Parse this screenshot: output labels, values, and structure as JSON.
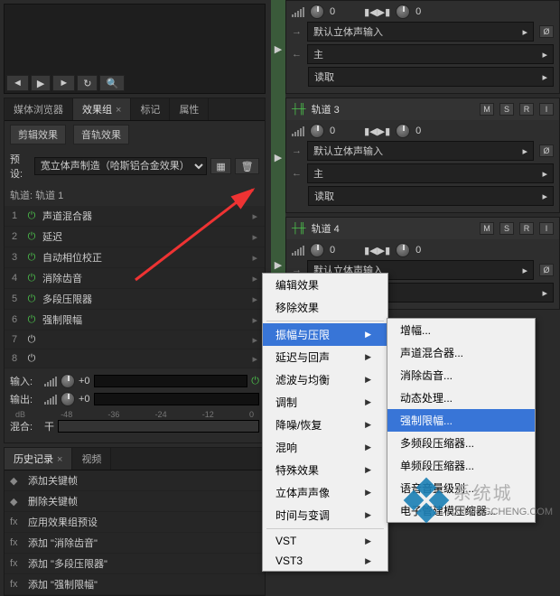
{
  "left": {
    "tabs": {
      "browser": "媒体浏览器",
      "fxgroup": "效果组",
      "marker": "标记",
      "props": "属性"
    },
    "subtabs": {
      "clip": "剪辑效果",
      "track": "音轨效果"
    },
    "preset_label": "预设:",
    "preset_value": "宽立体声制造（哈斯铝合金效果）",
    "track_label": "轨道: 轨道 1",
    "fx": [
      {
        "n": "1",
        "name": "声道混合器"
      },
      {
        "n": "2",
        "name": "延迟"
      },
      {
        "n": "3",
        "name": "自动相位校正"
      },
      {
        "n": "4",
        "name": "消除齿音"
      },
      {
        "n": "5",
        "name": "多段压限器"
      },
      {
        "n": "6",
        "name": "强制限幅"
      },
      {
        "n": "7",
        "name": ""
      },
      {
        "n": "8",
        "name": ""
      }
    ],
    "io": {
      "in_label": "输入:",
      "out_label": "输出:",
      "mix_label": "混合:",
      "in_val": "+0",
      "out_val": "+0",
      "mix_val": "干"
    },
    "db": [
      "dB",
      "-48",
      "-36",
      "-24",
      "-12",
      "0"
    ],
    "history": {
      "tabs": {
        "hist": "历史记录",
        "video": "视频"
      },
      "items": [
        {
          "ico": "◆",
          "text": "添加关键帧"
        },
        {
          "ico": "◆",
          "text": "删除关键帧"
        },
        {
          "ico": "fx",
          "text": "应用效果组预设"
        },
        {
          "ico": "fx",
          "text": "添加 \"消除齿音\""
        },
        {
          "ico": "fx",
          "text": "添加 \"多段压限器\""
        },
        {
          "ico": "fx",
          "text": "添加 \"强制限幅\""
        }
      ]
    }
  },
  "tracks": [
    {
      "name": "",
      "input": "默认立体声输入",
      "main": "主",
      "read": "读取",
      "vol": "0",
      "pan": "0"
    },
    {
      "name": "轨道 3",
      "input": "默认立体声输入",
      "main": "主",
      "read": "读取",
      "vol": "0",
      "pan": "0"
    },
    {
      "name": "轨道 4",
      "input": "默认立体声输入",
      "main": "主",
      "read": "",
      "vol": "0",
      "pan": "0"
    }
  ],
  "track_buttons": {
    "m": "M",
    "s": "S",
    "r": "R",
    "i": "I"
  },
  "menu1": {
    "edit": "编辑效果",
    "remove": "移除效果",
    "amp": "振幅与压限",
    "delay": "延迟与回声",
    "filter": "滤波与均衡",
    "mod": "调制",
    "nr": "降噪/恢复",
    "reverb": "混响",
    "special": "特殊效果",
    "stereo": "立体声声像",
    "time": "时间与变调",
    "vst": "VST",
    "vst3": "VST3"
  },
  "menu2": {
    "amp": "增幅...",
    "chmix": "声道混合器...",
    "deess": "消除齿音...",
    "dyn": "动态处理...",
    "limit": "强制限幅...",
    "mbc": "多频段压缩器...",
    "sbc": "单频段压缩器...",
    "gain": "语音音量级别...",
    "tube": "电子管建模压缩器..."
  },
  "watermark": {
    "brand": "系统城",
    "url": "XITONGCHENG.COM"
  }
}
